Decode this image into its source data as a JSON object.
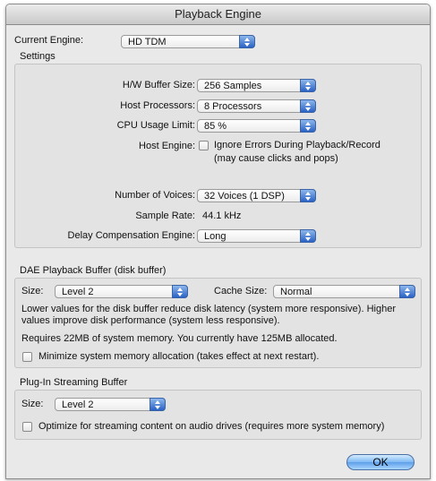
{
  "window": {
    "title": "Playback Engine"
  },
  "current_engine": {
    "label": "Current Engine:",
    "value": "HD TDM"
  },
  "settings": {
    "title": "Settings",
    "hw_buffer": {
      "label": "H/W Buffer Size:",
      "value": "256 Samples"
    },
    "host_processors": {
      "label": "Host Processors:",
      "value": "8 Processors"
    },
    "cpu_limit": {
      "label": "CPU Usage Limit:",
      "value": "85 %"
    },
    "host_engine": {
      "label": "Host Engine:",
      "option": "Ignore Errors During Playback/Record",
      "note": "(may cause clicks and pops)",
      "checked": false
    },
    "voices": {
      "label": "Number of Voices:",
      "value": "32 Voices (1 DSP)"
    },
    "sample_rate": {
      "label": "Sample Rate:",
      "value": "44.1 kHz"
    },
    "delay_comp": {
      "label": "Delay Compensation Engine:",
      "value": "Long"
    }
  },
  "dae": {
    "title": "DAE Playback Buffer (disk buffer)",
    "size": {
      "label": "Size:",
      "value": "Level 2"
    },
    "cache": {
      "label": "Cache Size:",
      "value": "Normal"
    },
    "desc_line1": "Lower values for the disk buffer reduce disk latency (system more responsive).  Higher",
    "desc_line2": "values improve disk performance (system less responsive).",
    "memory": "Requires 22MB of system memory. You currently have 125MB allocated.",
    "minimize": {
      "label": "Minimize system memory allocation (takes effect at next restart).",
      "checked": false
    }
  },
  "plugin": {
    "title": "Plug-In Streaming Buffer",
    "size": {
      "label": "Size:",
      "value": "Level 2"
    },
    "optimize": {
      "label": "Optimize for streaming content on audio drives (requires more system memory)",
      "checked": false
    }
  },
  "ok_label": "OK"
}
